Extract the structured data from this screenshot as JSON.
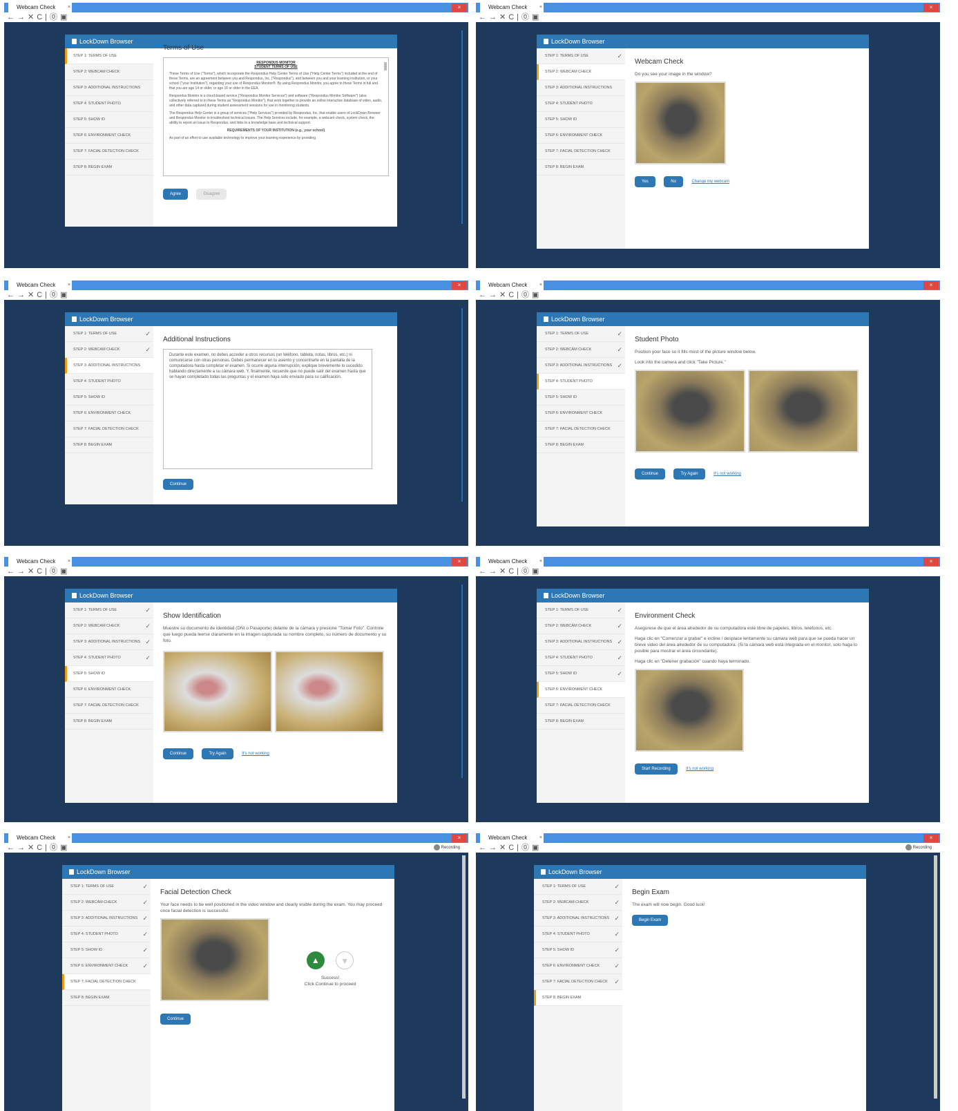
{
  "browser": {
    "tab_title": "Webcam Check",
    "tab_close": "×",
    "window_close": "×",
    "nav_glyphs": [
      "←",
      "→",
      "✕",
      "C",
      "|",
      "⓪",
      "▣"
    ],
    "recording": "Recording"
  },
  "app": {
    "title": "LockDown Browser"
  },
  "steps": [
    "STEP 1: TERMS OF USE",
    "STEP 2: WEBCAM CHECK",
    "STEP 3: ADDITIONAL INSTRUCTIONS",
    "STEP 4: STUDENT PHOTO",
    "STEP 5: SHOW ID",
    "STEP 6: ENVIRONMENT CHECK",
    "STEP 7: FACIAL DETECTION CHECK",
    "STEP 8: BEGIN EXAM"
  ],
  "check": "✓",
  "terms": {
    "heading": "Terms of Use",
    "doc_title_1": "RESPONDUS MONITOR",
    "doc_title_2": "STUDENT TERMS OF USE",
    "p1": "These Terms of Use (\"Terms\"), which incorporate the Respondus Help Center Terms of Use (\"Help Center Terms\") included at the end of these Terms, are an agreement between you and Respondus, Inc. (\"Respondus\"), and between you and your learning institution, or your school (\"your Institution\"), regarding your use of Respondus Monitor®. By using Respondus Monitor, you agree to these Terms in full and that you are age 14 or older, or age 16 or older in the EEA.",
    "p2": "Respondus Monitor is a cloud-based service (\"Respondus Monitor Services\") and software (\"Respondus Monitor Software\") (also collectively referred to in these Terms as \"Respondus Monitor\"), that work together to provide an online interactive database of video, audio, and other data captured during student assessment sessions for use in monitoring students.",
    "p3": "The Respondus Help Center is a group of services (\"Help Services\") provided by Respondus, Inc. that enable users of LockDown Browser and Respondus Monitor to troubleshoot technical issues. The Help Services include, for example, a webcam check, system check, the ability to report an issue to Respondus, and links to a knowledge base and technical support.",
    "p4": "REQUIREMENTS OF YOUR INSTITUTION (e.g., your school)",
    "p5": "As part of an effort to use available technology to improve your learning experience by providing",
    "agree": "Agree",
    "disagree": "Disagree"
  },
  "webcam": {
    "heading": "Webcam Check",
    "question": "Do you see your image in the window?",
    "yes": "Yes",
    "no": "No",
    "change": "Change my webcam"
  },
  "additional": {
    "heading": "Additional Instructions",
    "text": "Durante este examen, no debes acceder a otros recursos (un teléfono, tableta, notas, libros, etc.) ni comunicarse con otras personas. Debés permanecer en tu asiento y concentrarte en la pantalla de la computadora hasta completar el examen. Si ocurre alguna interrupción, explique brevemente lo sucedido hablando directamente a su cámara web. Y, finalmente, recuerde que no puede salir del examen hasta que se hayan completado todas las preguntas y el examen haya sido enviado para su calificación.",
    "continue": "Continue"
  },
  "photo": {
    "heading": "Student Photo",
    "line1": "Position your face so it fills most of the picture window below.",
    "line2": "Look into the camera and click \"Take Picture.\"",
    "continue": "Continue",
    "try_again": "Try Again",
    "not_working": "It's not working"
  },
  "showid": {
    "heading": "Show Identification",
    "text": "Muestre su documento de identidad (DNI o Pasaporte) delante de la cámara y presione \"Tomar Foto\". Controle que luego pueda leerse claramente en la imagen capturada su nombre completo, su número de documento y su foto.",
    "continue": "Continue",
    "try_again": "Try Again",
    "not_working": "It's not working"
  },
  "env": {
    "heading": "Environment Check",
    "p1": "Asegúrese de que el área alrededor de su computadora esté libre de papeles, libros, teléfonos, etc.",
    "p2": "Haga clic en \"Comenzar a grabar\" e incline / desplace lentamente su cámara web para que se pueda hacer un breve video del área alrededor de su computadora. (Si la cámara web está integrada en el monitor, solo haga lo posible para mostrar el área circundante).",
    "p3": "Haga clic en \"Detener grabación\" cuando haya terminado.",
    "start": "Start Recording",
    "not_working": "It's not working"
  },
  "facial": {
    "heading": "Facial Detection Check",
    "text": "Your face needs to be well positioned in the video window and clearly visible during the exam. You may proceed once facial detection is successful.",
    "success": "Success!",
    "proceed": "Click Continue to proceed",
    "continue": "Continue"
  },
  "begin": {
    "heading": "Begin Exam",
    "text": "The exam will now begin. Good luck!",
    "button": "Begin Exam"
  }
}
